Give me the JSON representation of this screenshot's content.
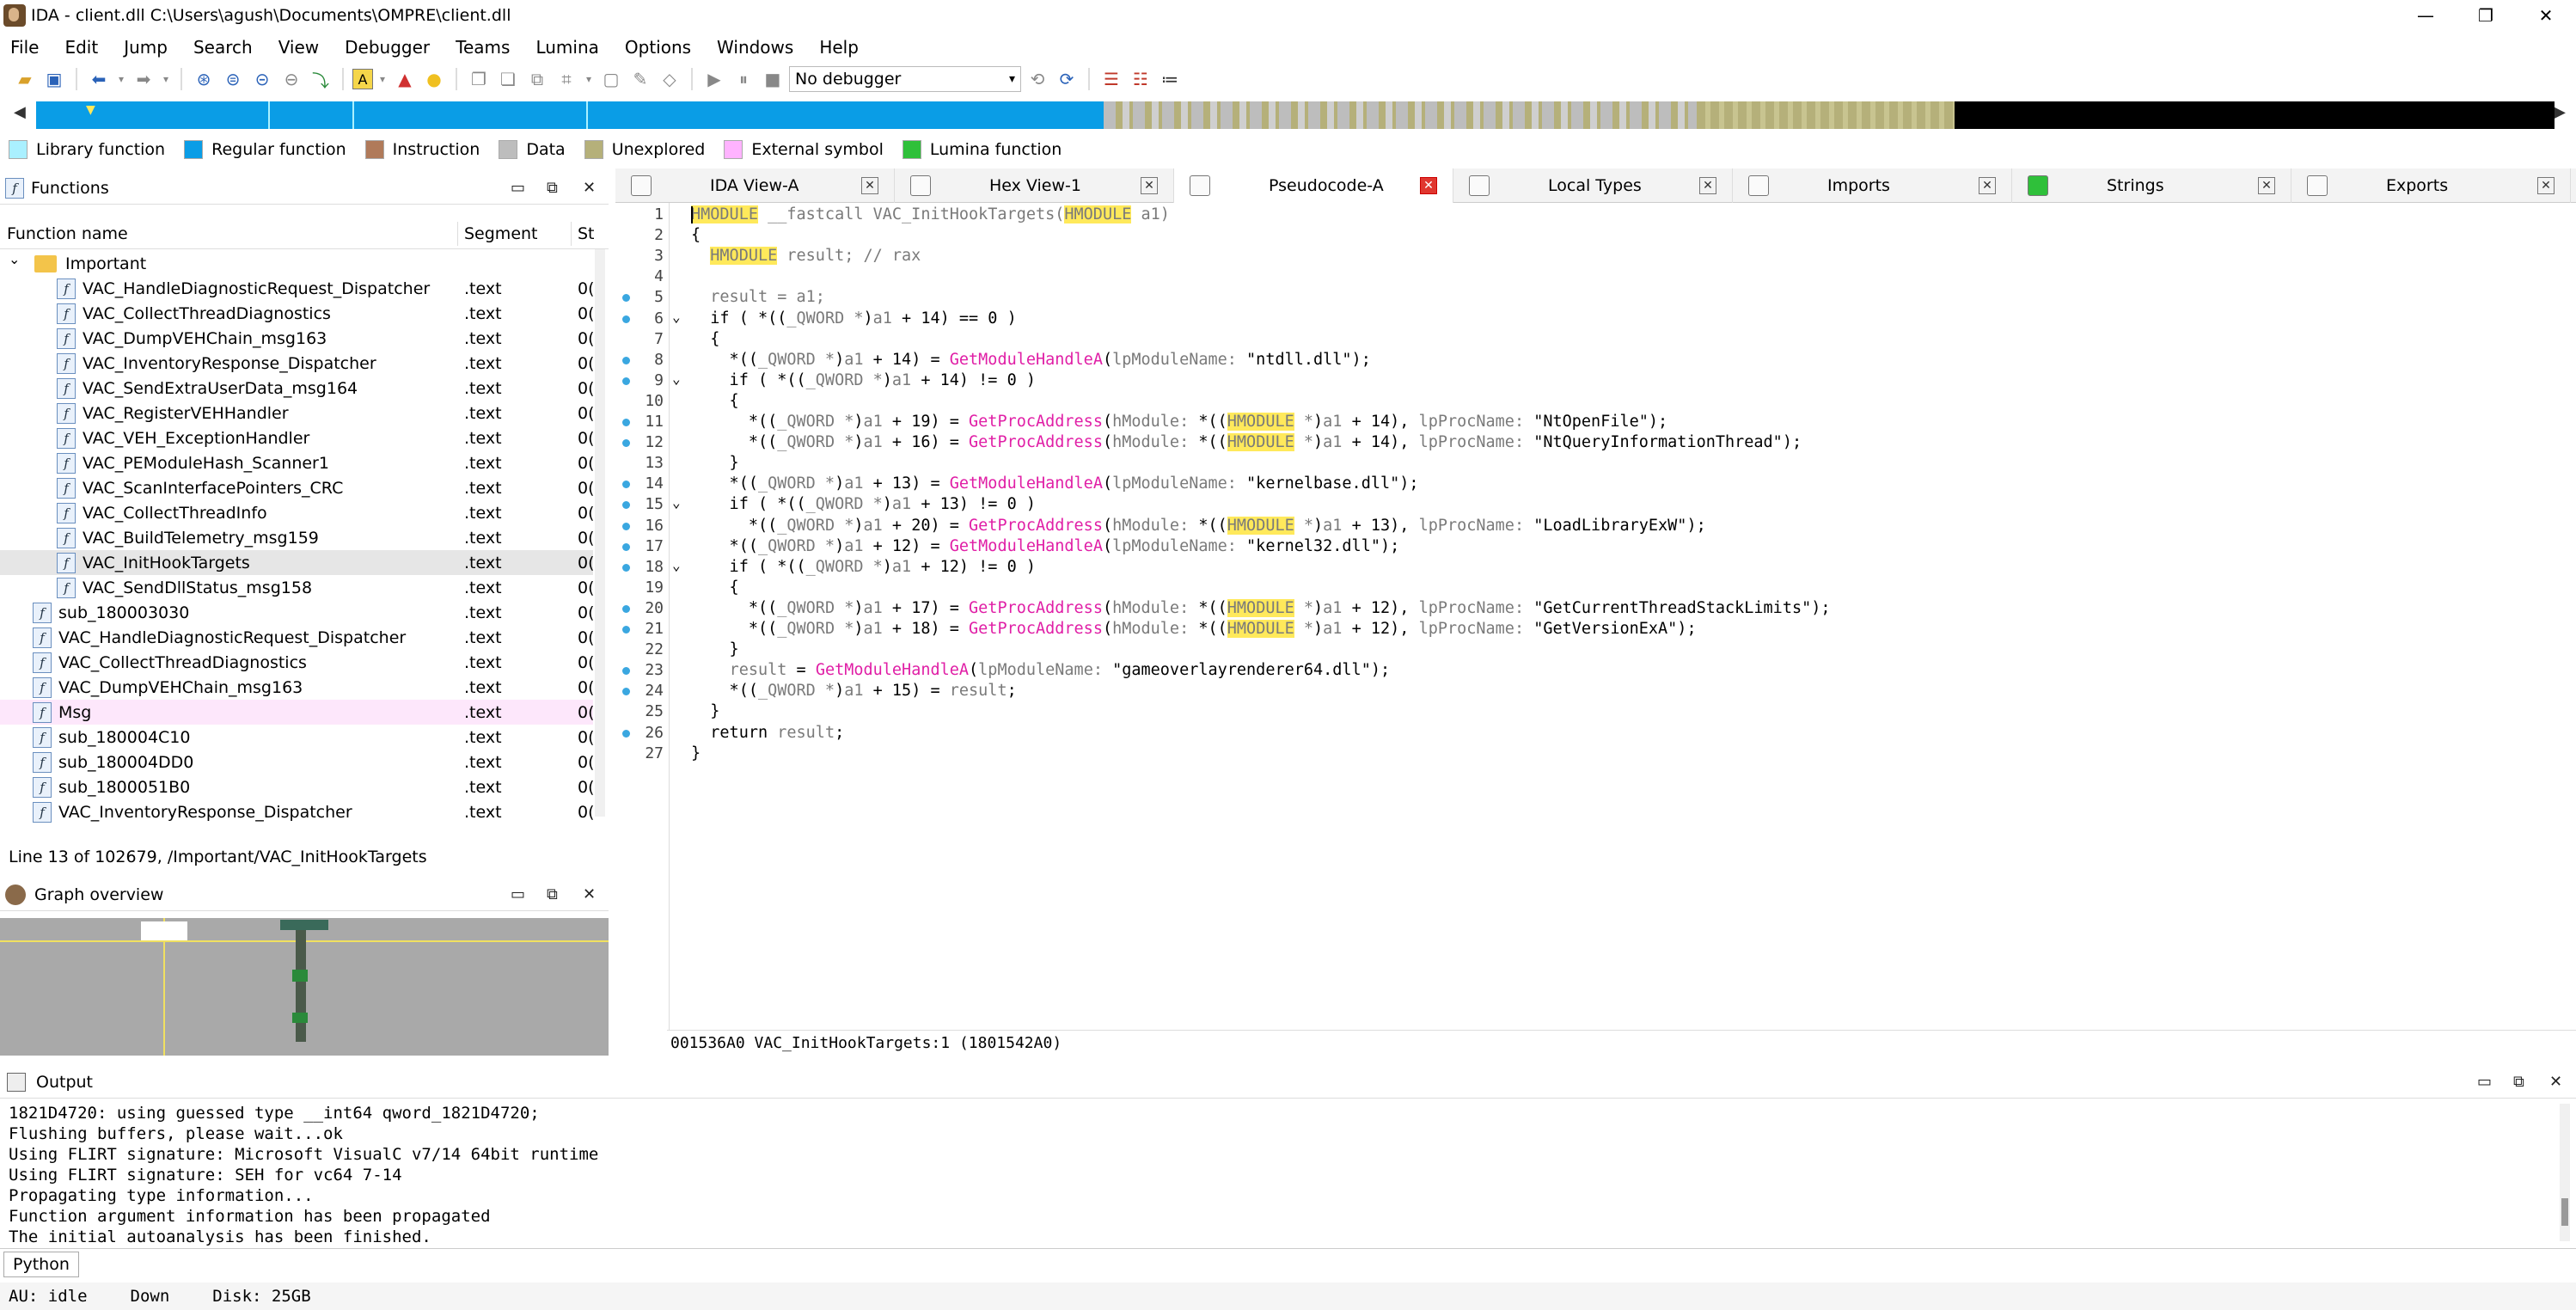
{
  "window": {
    "title": "IDA - client.dll C:\\Users\\agush\\Documents\\OMPRE\\client.dll",
    "minimize": "—",
    "maximize": "❐",
    "close": "✕"
  },
  "menu": [
    "File",
    "Edit",
    "Jump",
    "Search",
    "View",
    "Debugger",
    "Teams",
    "Lumina",
    "Options",
    "Windows",
    "Help"
  ],
  "toolbar": {
    "debugger": "No debugger"
  },
  "legend": [
    {
      "label": "Library function",
      "color": "#aaf0ff"
    },
    {
      "label": "Regular function",
      "color": "#0a9de6"
    },
    {
      "label": "Instruction",
      "color": "#b07a5a"
    },
    {
      "label": "Data",
      "color": "#bdbdbd"
    },
    {
      "label": "Unexplored",
      "color": "#b5b07a"
    },
    {
      "label": "External symbol",
      "color": "#ffb3ff"
    },
    {
      "label": "Lumina function",
      "color": "#2fc03a"
    }
  ],
  "functions": {
    "title": "Functions",
    "col_name": "Function name",
    "col_segment": "Segment",
    "col_start": "St",
    "rows": [
      {
        "name": "Important",
        "segment": "",
        "start": "",
        "kind": "folder",
        "indent": 0
      },
      {
        "name": "VAC_HandleDiagnosticRequest_Dispatcher",
        "segment": ".text",
        "start": "0(",
        "kind": "func",
        "indent": 1
      },
      {
        "name": "VAC_CollectThreadDiagnostics",
        "segment": ".text",
        "start": "0(",
        "kind": "func",
        "indent": 1
      },
      {
        "name": "VAC_DumpVEHChain_msg163",
        "segment": ".text",
        "start": "0(",
        "kind": "func",
        "indent": 1
      },
      {
        "name": "VAC_InventoryResponse_Dispatcher",
        "segment": ".text",
        "start": "0(",
        "kind": "func",
        "indent": 1
      },
      {
        "name": "VAC_SendExtraUserData_msg164",
        "segment": ".text",
        "start": "0(",
        "kind": "func",
        "indent": 1
      },
      {
        "name": "VAC_RegisterVEHHandler",
        "segment": ".text",
        "start": "0(",
        "kind": "func",
        "indent": 1
      },
      {
        "name": "VAC_VEH_ExceptionHandler",
        "segment": ".text",
        "start": "0(",
        "kind": "func",
        "indent": 1
      },
      {
        "name": "VAC_PEModuleHash_Scanner1",
        "segment": ".text",
        "start": "0(",
        "kind": "func",
        "indent": 1
      },
      {
        "name": "VAC_ScanInterfacePointers_CRC",
        "segment": ".text",
        "start": "0(",
        "kind": "func",
        "indent": 1
      },
      {
        "name": "VAC_CollectThreadInfo",
        "segment": ".text",
        "start": "0(",
        "kind": "func",
        "indent": 1
      },
      {
        "name": "VAC_BuildTelemetry_msg159",
        "segment": ".text",
        "start": "0(",
        "kind": "func",
        "indent": 1
      },
      {
        "name": "VAC_InitHookTargets",
        "segment": ".text",
        "start": "0(",
        "kind": "func",
        "indent": 1,
        "selected": true
      },
      {
        "name": "VAC_SendDllStatus_msg158",
        "segment": ".text",
        "start": "0(",
        "kind": "func",
        "indent": 1
      },
      {
        "name": "sub_180003030",
        "segment": ".text",
        "start": "0(",
        "kind": "func",
        "indent": 0
      },
      {
        "name": "VAC_HandleDiagnosticRequest_Dispatcher",
        "segment": ".text",
        "start": "0(",
        "kind": "func",
        "indent": 0
      },
      {
        "name": "VAC_CollectThreadDiagnostics",
        "segment": ".text",
        "start": "0(",
        "kind": "func",
        "indent": 0
      },
      {
        "name": "VAC_DumpVEHChain_msg163",
        "segment": ".text",
        "start": "0(",
        "kind": "func",
        "indent": 0
      },
      {
        "name": "Msg",
        "segment": ".text",
        "start": "0(",
        "kind": "func",
        "indent": 0,
        "pink": true
      },
      {
        "name": "sub_180004C10",
        "segment": ".text",
        "start": "0(",
        "kind": "func",
        "indent": 0
      },
      {
        "name": "sub_180004DD0",
        "segment": ".text",
        "start": "0(",
        "kind": "func",
        "indent": 0
      },
      {
        "name": "sub_1800051B0",
        "segment": ".text",
        "start": "0(",
        "kind": "func",
        "indent": 0
      },
      {
        "name": "VAC_InventoryResponse_Dispatcher",
        "segment": ".text",
        "start": "0(",
        "kind": "func",
        "indent": 0
      }
    ],
    "status": "Line 13 of 102679, /Important/VAC_InitHookTargets"
  },
  "graph": {
    "title": "Graph overview"
  },
  "tabs": [
    {
      "label": "IDA View-A",
      "active": false
    },
    {
      "label": "Hex View-1",
      "active": false
    },
    {
      "label": "Pseudocode-A",
      "active": true
    },
    {
      "label": "Local Types",
      "active": false
    },
    {
      "label": "Imports",
      "active": false
    },
    {
      "label": "Strings",
      "active": false
    },
    {
      "label": "Exports",
      "active": false
    }
  ],
  "code": [
    {
      "n": "1",
      "dot": false,
      "fold": false,
      "html": "<span class='hl'>HMODULE</span> <span class='ty'>__fastcall VAC_InitHookTargets(</span><span class='hl'>HMODULE</span><span class='ty'> a1)</span>"
    },
    {
      "n": "2",
      "dot": false,
      "fold": false,
      "html": "{"
    },
    {
      "n": "3",
      "dot": false,
      "fold": false,
      "html": "  <span class='hl'>HMODULE</span><span class='ty'> result; // rax</span>"
    },
    {
      "n": "4",
      "dot": false,
      "fold": false,
      "html": ""
    },
    {
      "n": "5",
      "dot": true,
      "fold": false,
      "html": "  <span class='ty'>result = a1;</span>"
    },
    {
      "n": "6",
      "dot": true,
      "fold": true,
      "html": "  if ( *((<span class='ty'>_QWORD *</span>)<span class='ty'>a1</span> + 14) == 0 )"
    },
    {
      "n": "7",
      "dot": false,
      "fold": false,
      "html": "  {"
    },
    {
      "n": "8",
      "dot": true,
      "fold": false,
      "html": "    *((<span class='ty'>_QWORD *</span>)<span class='ty'>a1</span> + 14) = <span class='fn'>GetModuleHandleA</span>(<span class='ty'>lpModuleName:</span> \"ntdll.dll\");"
    },
    {
      "n": "9",
      "dot": true,
      "fold": true,
      "html": "    if ( *((<span class='ty'>_QWORD *</span>)<span class='ty'>a1</span> + 14) != 0 )"
    },
    {
      "n": "10",
      "dot": false,
      "fold": false,
      "html": "    {"
    },
    {
      "n": "11",
      "dot": true,
      "fold": false,
      "html": "      *((<span class='ty'>_QWORD *</span>)<span class='ty'>a1</span> + 19) = <span class='fn'>GetProcAddress</span>(<span class='ty'>hModule:</span> *((<span class='hl'>HMODULE</span> <span class='ty'>*</span>)<span class='ty'>a1</span> + 14), <span class='ty'>lpProcName:</span> \"NtOpenFile\");"
    },
    {
      "n": "12",
      "dot": true,
      "fold": false,
      "html": "      *((<span class='ty'>_QWORD *</span>)<span class='ty'>a1</span> + 16) = <span class='fn'>GetProcAddress</span>(<span class='ty'>hModule:</span> *((<span class='hl'>HMODULE</span> <span class='ty'>*</span>)<span class='ty'>a1</span> + 14), <span class='ty'>lpProcName:</span> \"NtQueryInformationThread\");"
    },
    {
      "n": "13",
      "dot": false,
      "fold": false,
      "html": "    }"
    },
    {
      "n": "14",
      "dot": true,
      "fold": false,
      "html": "    *((<span class='ty'>_QWORD *</span>)<span class='ty'>a1</span> + 13) = <span class='fn'>GetModuleHandleA</span>(<span class='ty'>lpModuleName:</span> \"kernelbase.dll\");"
    },
    {
      "n": "15",
      "dot": true,
      "fold": true,
      "html": "    if ( *((<span class='ty'>_QWORD *</span>)<span class='ty'>a1</span> + 13) != 0 )"
    },
    {
      "n": "16",
      "dot": true,
      "fold": false,
      "html": "      *((<span class='ty'>_QWORD *</span>)<span class='ty'>a1</span> + 20) = <span class='fn'>GetProcAddress</span>(<span class='ty'>hModule:</span> *((<span class='hl'>HMODULE</span> <span class='ty'>*</span>)<span class='ty'>a1</span> + 13), <span class='ty'>lpProcName:</span> \"LoadLibraryExW\");"
    },
    {
      "n": "17",
      "dot": true,
      "fold": false,
      "html": "    *((<span class='ty'>_QWORD *</span>)<span class='ty'>a1</span> + 12) = <span class='fn'>GetModuleHandleA</span>(<span class='ty'>lpModuleName:</span> \"kernel32.dll\");"
    },
    {
      "n": "18",
      "dot": true,
      "fold": true,
      "html": "    if ( *((<span class='ty'>_QWORD *</span>)<span class='ty'>a1</span> + 12) != 0 )"
    },
    {
      "n": "19",
      "dot": false,
      "fold": false,
      "html": "    {"
    },
    {
      "n": "20",
      "dot": true,
      "fold": false,
      "html": "      *((<span class='ty'>_QWORD *</span>)<span class='ty'>a1</span> + 17) = <span class='fn'>GetProcAddress</span>(<span class='ty'>hModule:</span> *((<span class='hl'>HMODULE</span> <span class='ty'>*</span>)<span class='ty'>a1</span> + 12), <span class='ty'>lpProcName:</span> \"GetCurrentThreadStackLimits\");"
    },
    {
      "n": "21",
      "dot": true,
      "fold": false,
      "html": "      *((<span class='ty'>_QWORD *</span>)<span class='ty'>a1</span> + 18) = <span class='fn'>GetProcAddress</span>(<span class='ty'>hModule:</span> *((<span class='hl'>HMODULE</span> <span class='ty'>*</span>)<span class='ty'>a1</span> + 12), <span class='ty'>lpProcName:</span> \"GetVersionExA\");"
    },
    {
      "n": "22",
      "dot": false,
      "fold": false,
      "html": "    }"
    },
    {
      "n": "23",
      "dot": true,
      "fold": false,
      "html": "    <span class='ty'>result</span> = <span class='fn'>GetModuleHandleA</span>(<span class='ty'>lpModuleName:</span> \"gameoverlayrenderer64.dll\");"
    },
    {
      "n": "24",
      "dot": true,
      "fold": false,
      "html": "    *((<span class='ty'>_QWORD *</span>)<span class='ty'>a1</span> + 15) = <span class='ty'>result</span>;"
    },
    {
      "n": "25",
      "dot": false,
      "fold": false,
      "html": "  }"
    },
    {
      "n": "26",
      "dot": true,
      "fold": false,
      "html": "  return <span class='ty'>result</span>;"
    },
    {
      "n": "27",
      "dot": false,
      "fold": false,
      "html": "}"
    }
  ],
  "code_status": "001536A0 VAC_InitHookTargets:1 (1801542A0)",
  "output": {
    "title": "Output",
    "lines": [
      "1821D4720: using guessed type __int64 qword_1821D4720;",
      "Flushing buffers, please wait...ok",
      "Using FLIRT signature: Microsoft VisualC v7/14 64bit runtime",
      "Using FLIRT signature: SEH for vc64 7-14",
      "Propagating type information...",
      "Function argument information has been propagated",
      "The initial autoanalysis has been finished."
    ]
  },
  "python_label": "Python",
  "statusbar": {
    "au": "AU:  idle",
    "dir": "Down",
    "disk": "Disk: 25GB"
  }
}
